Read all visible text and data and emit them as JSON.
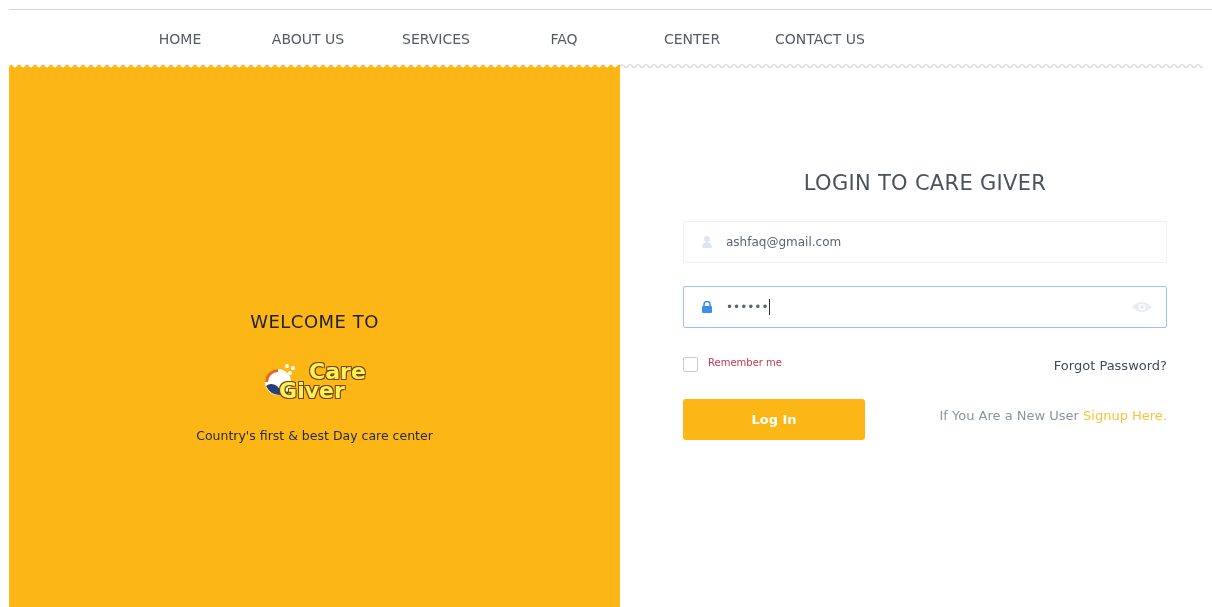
{
  "nav": {
    "items": [
      {
        "label": "HOME"
      },
      {
        "label": "ABOUT US"
      },
      {
        "label": "SERVICES"
      },
      {
        "label": "FAQ"
      },
      {
        "label": "CENTER"
      },
      {
        "label": "CONTACT US"
      }
    ]
  },
  "welcome": {
    "heading": "WELCOME TO",
    "logo_line_1": "Care",
    "logo_line_2": "Giver",
    "tagline": "Country's first & best Day care center"
  },
  "login": {
    "title": "LOGIN TO CARE GIVER",
    "email": {
      "value": "ashfaq@gmail.com",
      "focused": false
    },
    "password": {
      "value": "••••••",
      "focused": true
    },
    "remember": {
      "label": "Remember me",
      "checked": false
    },
    "forgot": "Forgot Password?",
    "button": "Log In",
    "signup_text": "If You Are a New User",
    "signup_link": "Signup Here."
  }
}
